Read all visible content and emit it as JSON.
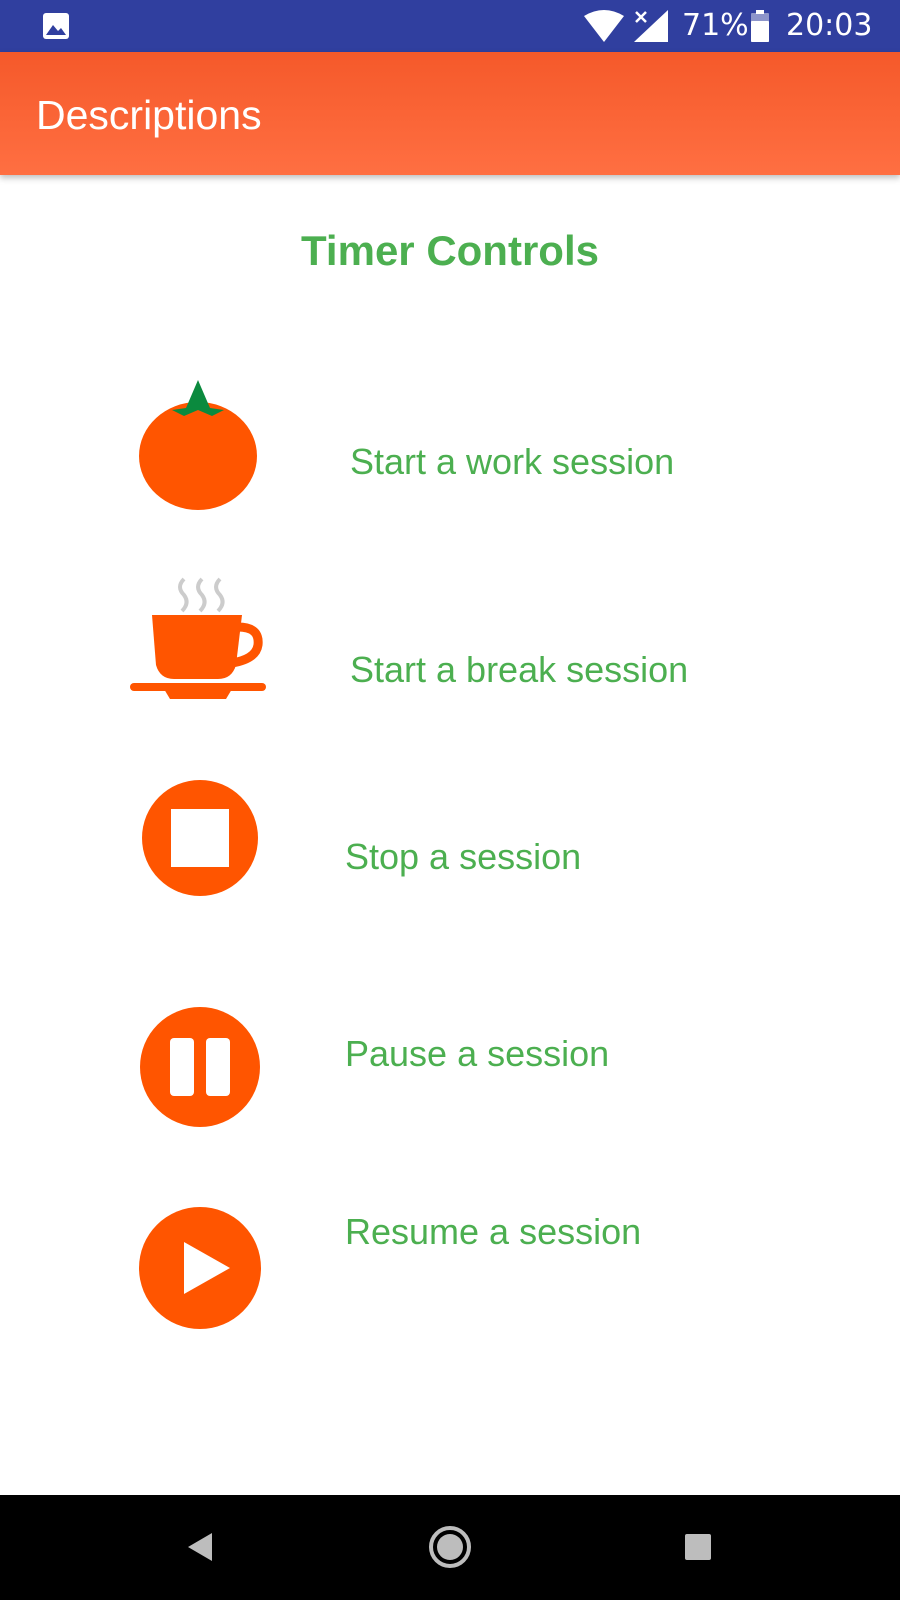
{
  "status_bar": {
    "battery_percent": "71%",
    "time": "20:03",
    "icons": [
      "gallery-icon",
      "wifi-icon",
      "signal-icon",
      "battery-icon"
    ]
  },
  "app_bar": {
    "title": "Descriptions"
  },
  "section": {
    "title": "Timer Controls"
  },
  "controls": [
    {
      "icon": "tomato-icon",
      "label": "Start a work session"
    },
    {
      "icon": "coffee-cup-icon",
      "label": "Start a break session"
    },
    {
      "icon": "stop-icon",
      "label": "Stop a session"
    },
    {
      "icon": "pause-icon",
      "label": "Pause a session"
    },
    {
      "icon": "play-icon",
      "label": "Resume a session"
    }
  ],
  "nav_bar": {
    "buttons": [
      "back-icon",
      "home-icon",
      "recents-icon"
    ]
  },
  "colors": {
    "status_bar": "#303f9f",
    "app_bar": "#ff6f42",
    "accent_orange": "#ff5500",
    "label_green": "#4caf50"
  }
}
